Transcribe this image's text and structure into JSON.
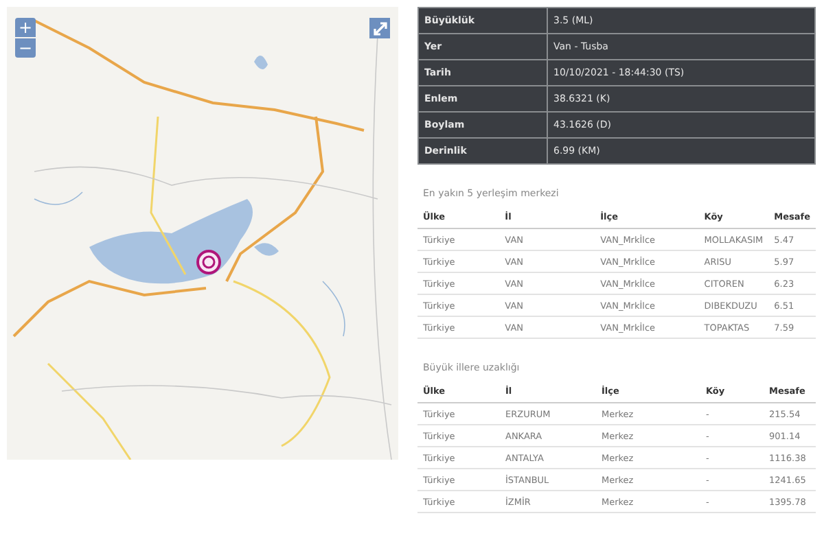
{
  "map": {
    "controls": [
      {
        "kind": "zoom_in",
        "label": "+"
      },
      {
        "kind": "zoom_out",
        "label": "−"
      },
      {
        "kind": "fullscreen"
      }
    ]
  },
  "details": [
    {
      "label": "Büyüklük",
      "value": "3.5 (ML)"
    },
    {
      "label": "Yer",
      "value": "Van - Tusba"
    },
    {
      "label": "Tarih",
      "value": "10/10/2021 - 18:44:30 (TS)"
    },
    {
      "label": "Enlem",
      "value": "38.6321 (K)"
    },
    {
      "label": "Boylam",
      "value": "43.1626 (D)"
    },
    {
      "label": "Derinlik",
      "value": "6.99 (KM)"
    }
  ],
  "tables": [
    {
      "caption": "En yakın 5 yerleşim merkezi",
      "columns": [
        "Ülke",
        "İl",
        "İlçe",
        "Köy",
        "Mesafe"
      ],
      "rows": [
        [
          "Türkiye",
          "VAN",
          "VAN_Mrkİlce",
          "MOLLAKASIM",
          "5.47"
        ],
        [
          "Türkiye",
          "VAN",
          "VAN_Mrkİlce",
          "ARISU",
          "5.97"
        ],
        [
          "Türkiye",
          "VAN",
          "VAN_Mrkİlce",
          "CITOREN",
          "6.23"
        ],
        [
          "Türkiye",
          "VAN",
          "VAN_Mrkİlce",
          "DIBEKDUZU",
          "6.51"
        ],
        [
          "Türkiye",
          "VAN",
          "VAN_Mrkİlce",
          "TOPAKTAS",
          "7.59"
        ]
      ]
    },
    {
      "caption": "Büyük illere uzaklığı",
      "columns": [
        "Ülke",
        "İl",
        "İlçe",
        "Köy",
        "Mesafe"
      ],
      "rows": [
        [
          "Türkiye",
          "ERZURUM",
          "Merkez",
          "-",
          "215.54"
        ],
        [
          "Türkiye",
          "ANKARA",
          "Merkez",
          "-",
          "901.14"
        ],
        [
          "Türkiye",
          "ANTALYA",
          "Merkez",
          "-",
          "1116.38"
        ],
        [
          "Türkiye",
          "İSTANBUL",
          "Merkez",
          "-",
          "1241.65"
        ],
        [
          "Türkiye",
          "İZMİR",
          "Merkez",
          "-",
          "1395.78"
        ]
      ]
    }
  ]
}
